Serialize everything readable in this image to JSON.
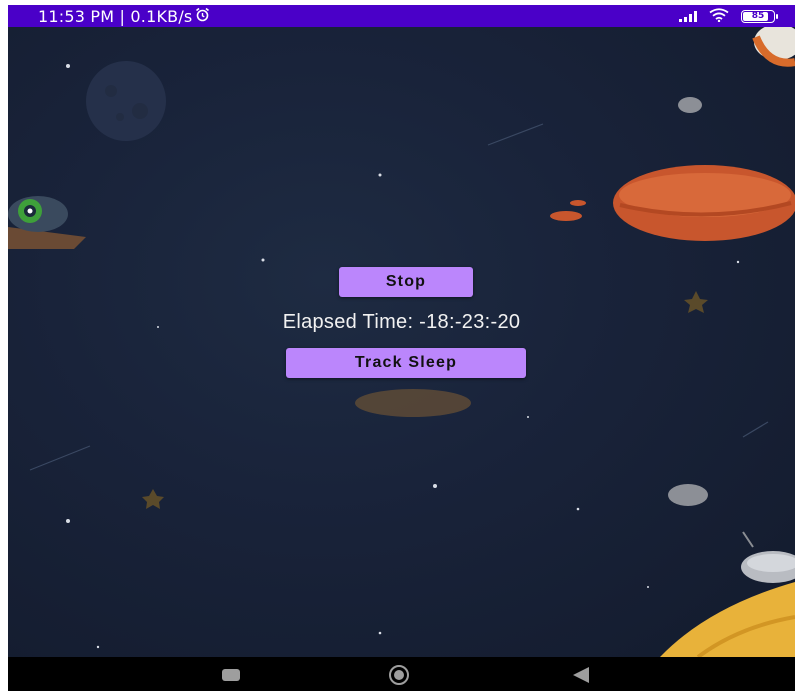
{
  "status_bar": {
    "left_text": "11:53 PM | 0.1KB/s",
    "alarm_icon": "alarm-clock-icon",
    "signal_icon": "cell-signal-icon",
    "wifi_icon": "wifi-icon",
    "battery_percent": "85",
    "battery_level": 0.85,
    "color": "#4a00c8"
  },
  "main": {
    "stop_label": "Stop",
    "elapsed_text": "Elapsed Time: -18:-23:-20",
    "track_label": "Track Sleep",
    "button_color": "#bb86fc"
  },
  "nav_bar": {
    "recents_icon": "recents-square-icon",
    "home_icon": "home-circle-icon",
    "back_icon": "back-triangle-icon"
  }
}
